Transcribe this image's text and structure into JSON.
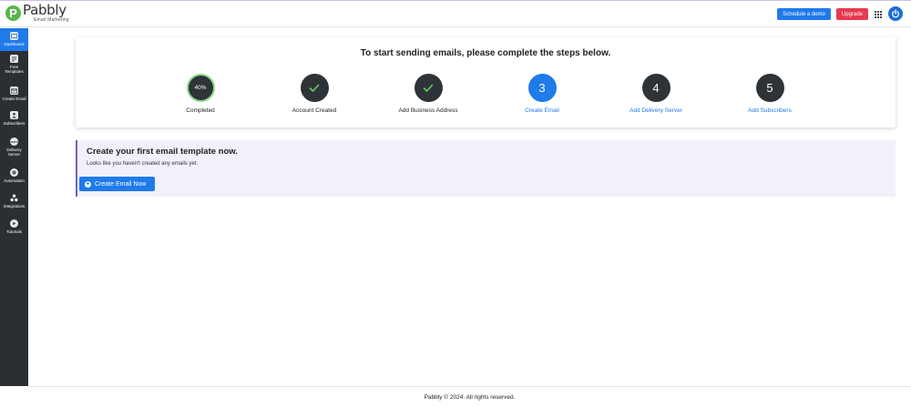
{
  "header": {
    "logo_name": "Pabbly",
    "logo_sub": "Email Marketing",
    "schedule_demo_label": "Schedule a demo",
    "upgrade_label": "Upgrade",
    "colors": {
      "primary": "#1f7aea",
      "upgrade": "#e53a4f",
      "sidebar": "#2b2f33"
    }
  },
  "sidebar": {
    "items": [
      {
        "label": "Dashboard",
        "icon": "dashboard-icon",
        "active": true
      },
      {
        "label": "Free Templates",
        "icon": "templates-icon",
        "active": false
      },
      {
        "label": "Create Email",
        "icon": "envelope-icon",
        "active": false
      },
      {
        "label": "Subscribers",
        "icon": "subscribers-icon",
        "active": false
      },
      {
        "label": "Delivery Server",
        "icon": "smtp-icon",
        "active": false
      },
      {
        "label": "Automation",
        "icon": "automation-icon",
        "active": false
      },
      {
        "label": "Integrations",
        "icon": "integrations-icon",
        "active": false
      },
      {
        "label": "Tutorials",
        "icon": "play-icon",
        "active": false
      }
    ]
  },
  "steps": {
    "title": "To start sending emails, please complete the steps below.",
    "progress_text": "40%",
    "progress": 0.4,
    "items": [
      {
        "label": "Completed",
        "state": "progress"
      },
      {
        "label": "Account Created",
        "state": "done"
      },
      {
        "label": "Add Business Address",
        "state": "done"
      },
      {
        "number": "3",
        "label": "Create Email",
        "state": "current"
      },
      {
        "number": "4",
        "label": "Add Delivery Server",
        "state": "pending"
      },
      {
        "number": "5",
        "label": "Add Subscribers",
        "state": "pending"
      }
    ]
  },
  "email_panel": {
    "title": "Create your first email template now.",
    "subtitle": "Looks like you haven't created any emails yet.",
    "button_label": "Create Email Now"
  },
  "footer": {
    "text": "Pabbly © 2024. All rights reserved."
  }
}
